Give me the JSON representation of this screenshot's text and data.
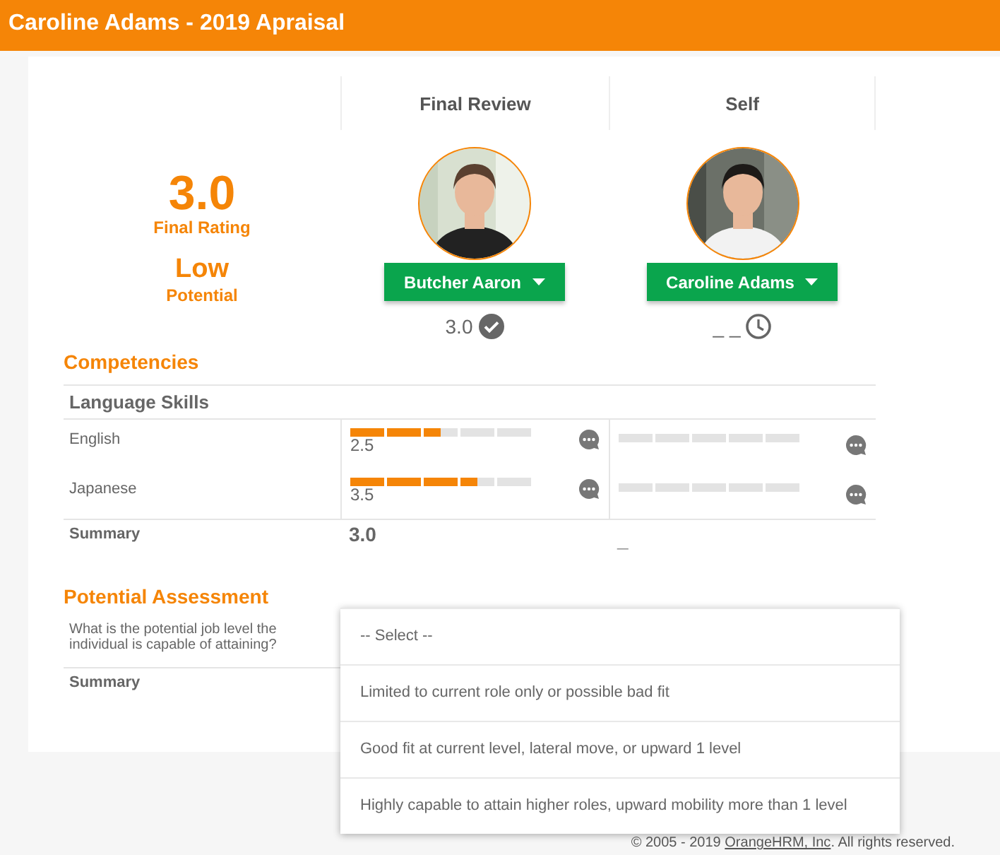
{
  "header": {
    "title": "Caroline Adams - 2019 Apraisal"
  },
  "columns": [
    {
      "label": "Final Review"
    },
    {
      "label": "Self"
    }
  ],
  "overall": {
    "rating": "3.0",
    "rating_label": "Final Rating",
    "potential": "Low",
    "potential_label": "Potential"
  },
  "reviewers": [
    {
      "name": "Butcher Aaron",
      "score": "3.0",
      "kind": "completed"
    },
    {
      "name": "Caroline Adams",
      "score": "_ _",
      "kind": "pending"
    }
  ],
  "competencies": {
    "title": "Competencies",
    "group": "Language Skills",
    "rows": [
      {
        "name": "English",
        "ratings": [
          {
            "level": 0.5,
            "reading": "2.5"
          },
          {
            "level": 0
          }
        ]
      },
      {
        "name": "Japanese",
        "ratings": [
          {
            "level": 0.7,
            "reading": "3.5"
          },
          {
            "level": 0
          }
        ]
      }
    ],
    "summary": {
      "label": "Summary",
      "values": [
        "3.0",
        "_"
      ]
    }
  },
  "potential_assessment": {
    "title": "Potential Assessment",
    "question": "What is the potential job level the individual is capable of attaining?",
    "summary_label": "Summary"
  },
  "dropdown": {
    "options": [
      "-- Select --",
      "Limited to current role only or possible bad fit",
      "Good fit at current level, lateral move, or upward 1 level",
      "Highly capable to attain higher roles, upward mobility more than 1 level"
    ]
  },
  "footer": {
    "prefix": "© 2005 - 2019 ",
    "link": "OrangeHRM, Inc",
    "suffix": ". All rights reserved."
  }
}
